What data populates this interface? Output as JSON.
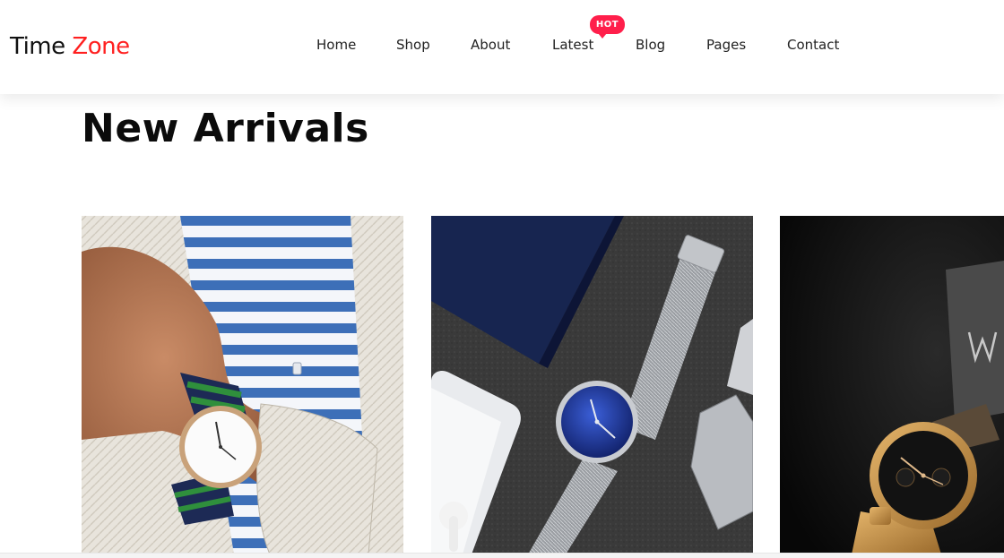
{
  "header": {
    "logo": {
      "part1": "Time ",
      "part2": "Zone"
    },
    "nav": [
      {
        "label": "Home"
      },
      {
        "label": "Shop"
      },
      {
        "label": "About"
      },
      {
        "label": "Latest"
      },
      {
        "label": "Blog"
      },
      {
        "label": "Pages"
      },
      {
        "label": "Contact"
      }
    ],
    "badge": "HOT"
  },
  "main": {
    "title": "New Arrivals",
    "products": [
      {
        "image": "wrist-watch-nato-strap-photo"
      },
      {
        "image": "blue-dial-mesh-watch-photo"
      },
      {
        "image": "gold-chronograph-watch-photo"
      }
    ]
  },
  "colors": {
    "accent": "#ff2020",
    "badge": "#ff1f4b",
    "text": "#111111"
  }
}
